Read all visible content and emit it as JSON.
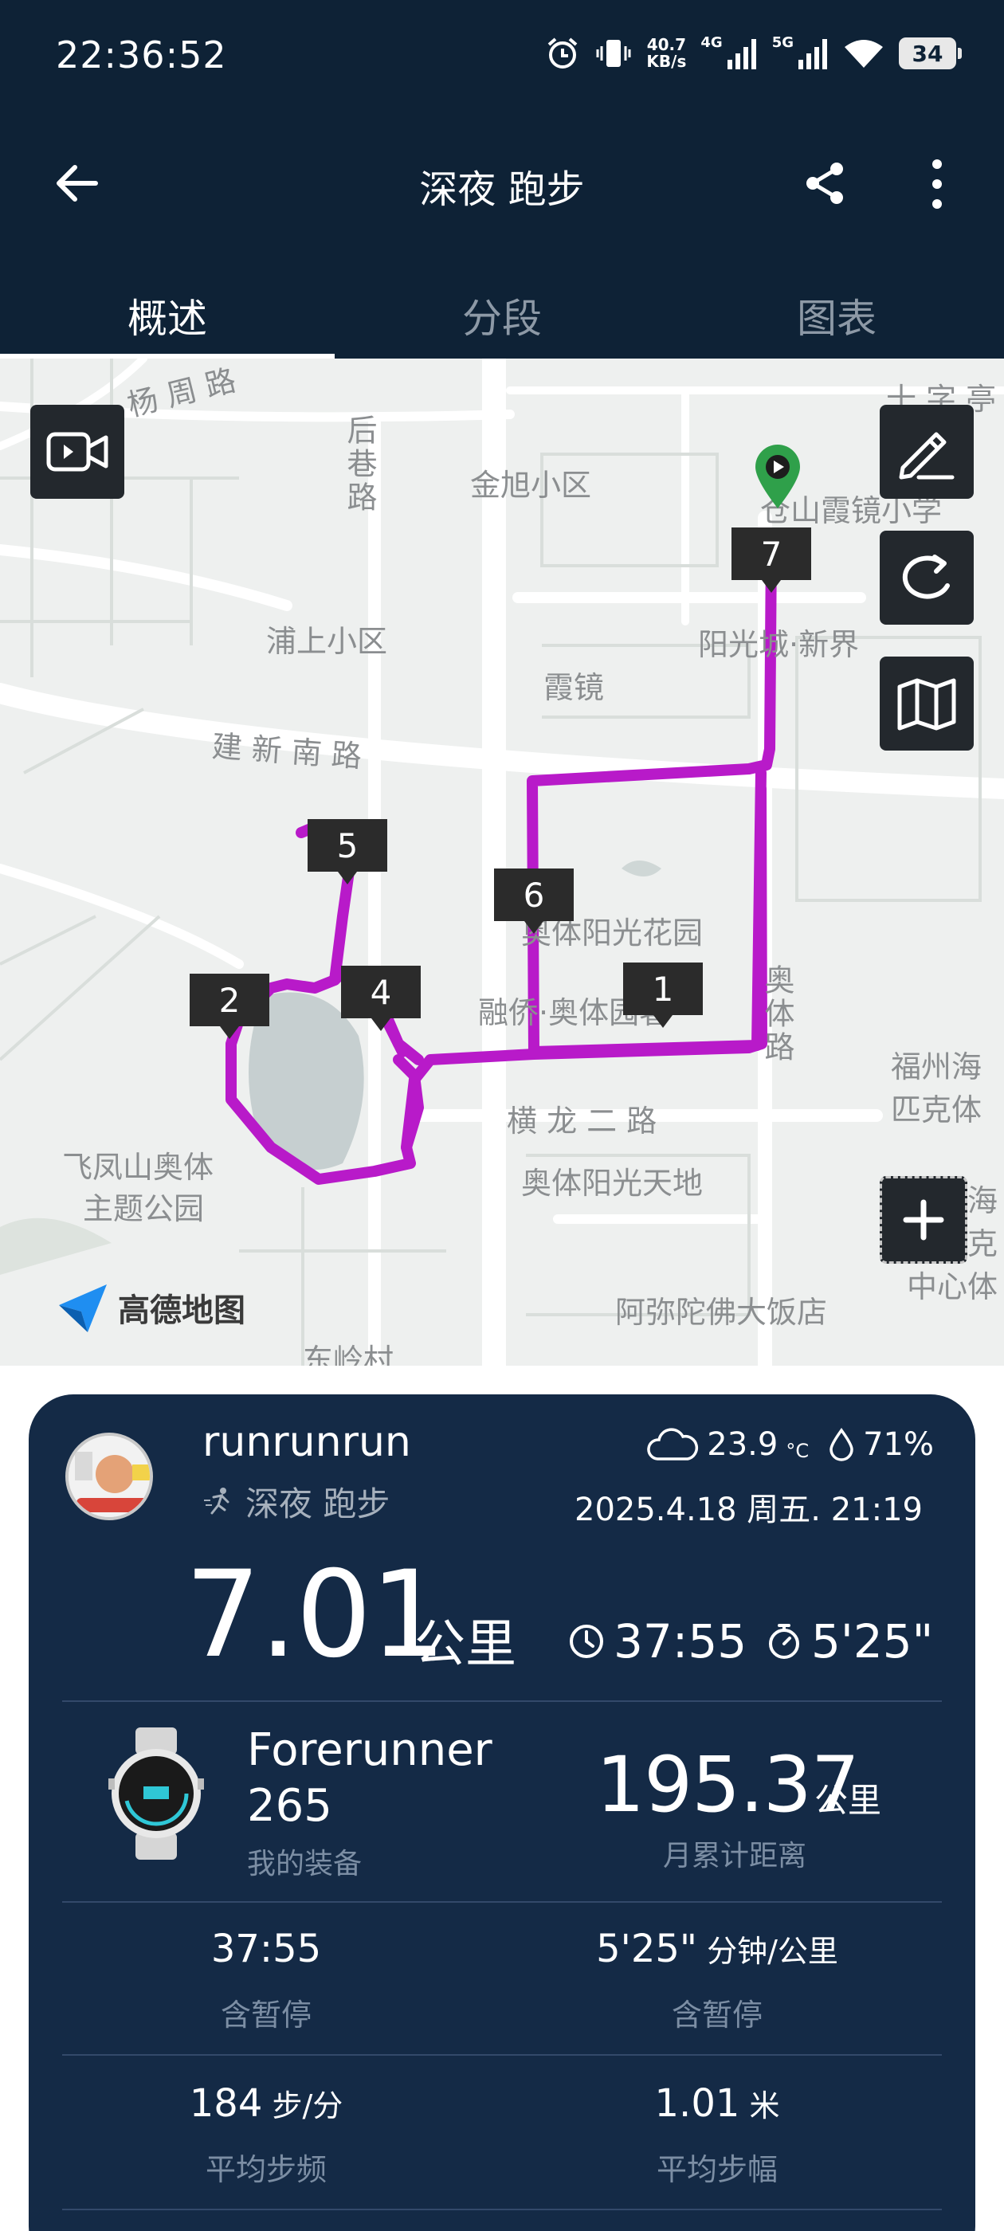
{
  "status_bar": {
    "time": "22:36:52",
    "net_speed_value": "40.7",
    "net_speed_unit": "KB/s",
    "signal_1_label": "4G",
    "signal_2_label": "5G",
    "battery": "34"
  },
  "header": {
    "title": "深夜 跑步"
  },
  "tabs": [
    {
      "label": "概述",
      "active": true
    },
    {
      "label": "分段",
      "active": false
    },
    {
      "label": "图表",
      "active": false
    }
  ],
  "map": {
    "labels": {
      "yangzhou_road": "杨 周 路",
      "houxiang_road": "后巷路",
      "jinxu": "金旭小区",
      "shizi": "十 字 亭",
      "cangshan_school": "仓山霞镜小学",
      "pushang": "浦上小区",
      "xiajing": "霞镜",
      "yangguangcheng": "阳光城·新界",
      "jianxin_south": "建 新 南 路",
      "aoti_garden": "奥体阳光花园",
      "rongqiao": "融侨·奥体园著",
      "aoti_road": "奥体路",
      "fuzhou_olympic_1": "福州海",
      "fuzhou_olympic_2": "匹克体",
      "henglong": "横 龙 二 路",
      "aoti_tiandi": "奥体阳光天地",
      "feifeng_1": "飞凤山奥体",
      "feifeng_2": "主题公园",
      "fuzhou_right_1": "福州海",
      "fuzhou_right_2": "林匹克",
      "fuzhou_right_3": "中心体",
      "amituofo": "阿弥陀佛大饭店",
      "dongling": "东岭村",
      "amap_brand": "高德地图"
    },
    "markers": [
      "1",
      "2",
      "4",
      "5",
      "6",
      "7"
    ],
    "route_color": "#b81ac9"
  },
  "summary": {
    "username": "runrunrun",
    "activity": "深夜 跑步",
    "temperature": "23.9",
    "temp_unit": "°C",
    "humidity": "71%",
    "datetime": "2025.4.18 周五. 21:19",
    "distance": "7.01",
    "distance_unit": "公里",
    "duration": "37:55",
    "pace": "5'25\"",
    "device_name_1": "Forerunner",
    "device_name_2": "265",
    "device_label": "我的装备",
    "month_distance": "195.37",
    "month_distance_unit": "公里",
    "month_distance_label": "月累计距离"
  },
  "stats": [
    {
      "value": "37:55",
      "unit": "",
      "label": "含暂停"
    },
    {
      "value": "5'25\"",
      "unit": " 分钟/公里",
      "label": "含暂停"
    },
    {
      "value": "184",
      "unit": " 步/分",
      "label": "平均步频"
    },
    {
      "value": "1.01",
      "unit": " 米",
      "label": "平均步幅"
    }
  ]
}
